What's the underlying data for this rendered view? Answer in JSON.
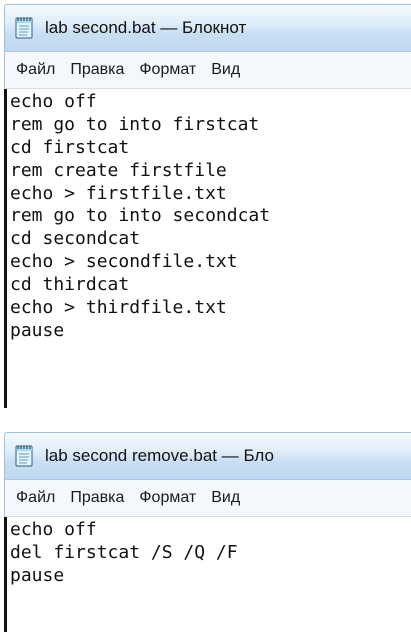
{
  "windows": [
    {
      "title": "lab second.bat — Блокнот",
      "menu": [
        "Файл",
        "Правка",
        "Формат",
        "Вид"
      ],
      "lines": [
        "echo off",
        "rem go to into firstcat",
        "cd firstcat",
        "rem create firstfile",
        "echo > firstfile.txt",
        "rem go to into secondcat",
        "cd secondcat",
        "echo > secondfile.txt",
        "cd thirdcat",
        "echo > thirdfile.txt",
        "pause"
      ]
    },
    {
      "title": "lab second remove.bat — Бло",
      "menu": [
        "Файл",
        "Правка",
        "Формат",
        "Вид"
      ],
      "lines": [
        "echo off",
        "del firstcat /S /Q /F",
        "pause"
      ]
    }
  ],
  "colors": {
    "title_gradient_top": "#f5fbff",
    "title_gradient_bottom": "#bfd8ef",
    "menu_background": "#f4f7fb",
    "text": "#111111",
    "notepad_icon": "#dff6ff"
  }
}
